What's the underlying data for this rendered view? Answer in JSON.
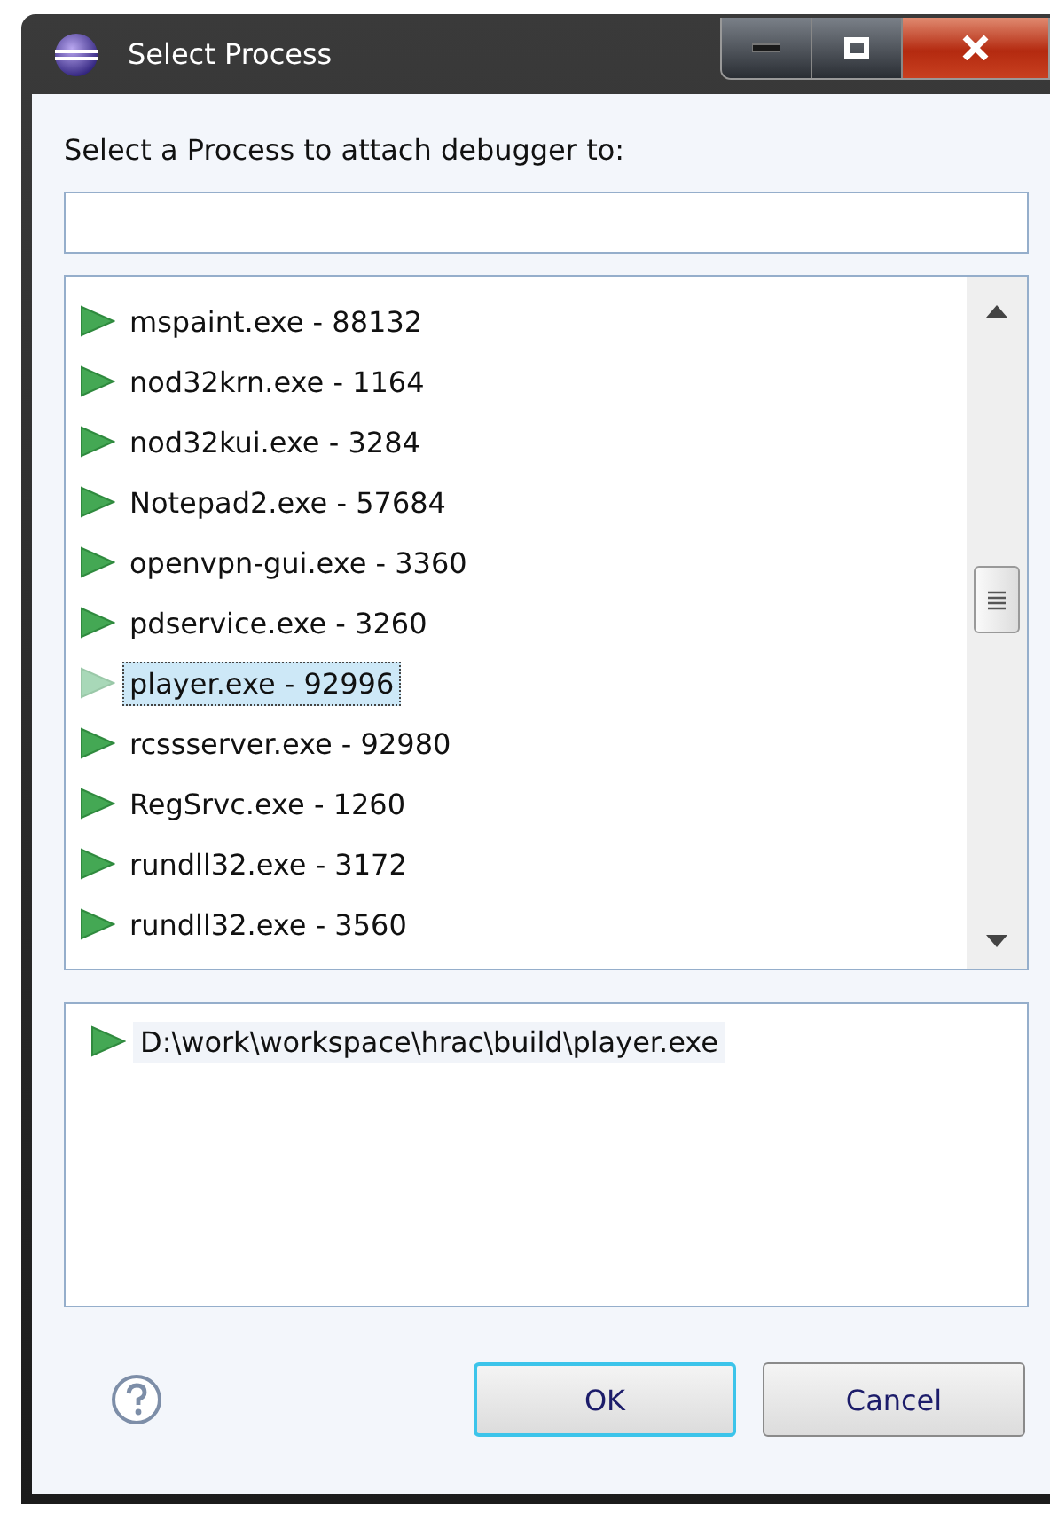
{
  "window": {
    "title": "Select Process"
  },
  "prompt": "Select a Process to attach debugger to:",
  "processes": [
    {
      "label": "mspaint.exe - 88132",
      "selected": false
    },
    {
      "label": "nod32krn.exe - 1164",
      "selected": false
    },
    {
      "label": "nod32kui.exe - 3284",
      "selected": false
    },
    {
      "label": "Notepad2.exe - 57684",
      "selected": false
    },
    {
      "label": "openvpn-gui.exe - 3360",
      "selected": false
    },
    {
      "label": "pdservice.exe - 3260",
      "selected": false
    },
    {
      "label": "player.exe - 92996",
      "selected": true
    },
    {
      "label": "rcssserver.exe - 92980",
      "selected": false
    },
    {
      "label": "RegSrvc.exe - 1260",
      "selected": false
    },
    {
      "label": "rundll32.exe - 3172",
      "selected": false
    },
    {
      "label": "rundll32.exe - 3560",
      "selected": false
    }
  ],
  "details": [
    {
      "label": "D:\\work\\workspace\\hrac\\build\\player.exe"
    }
  ],
  "buttons": [
    {
      "label": "OK",
      "default": true
    },
    {
      "label": "Cancel",
      "default": false
    }
  ]
}
